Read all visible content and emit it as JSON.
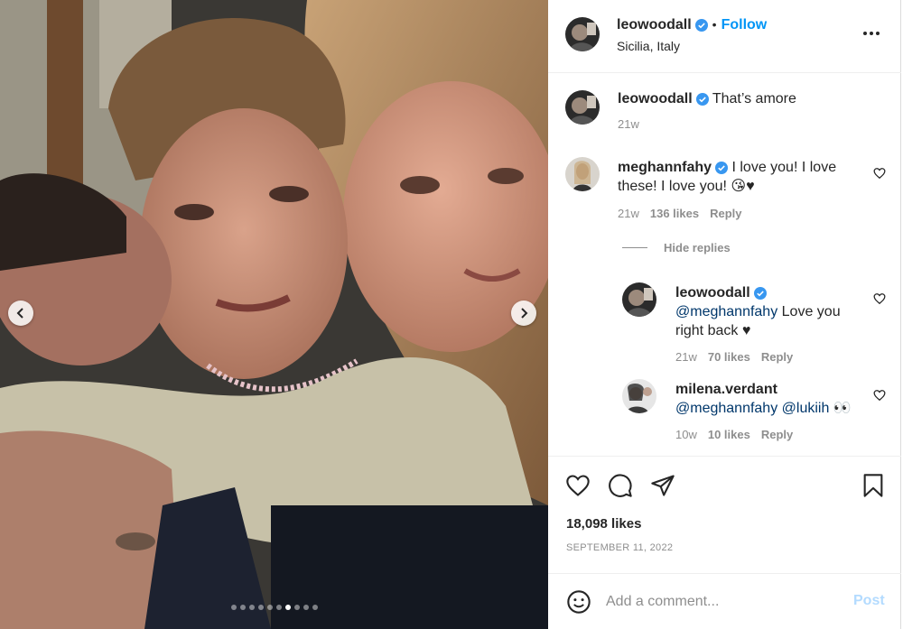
{
  "post": {
    "author": "leowoodall",
    "location": "Sicilia, Italy",
    "follow_label": "Follow",
    "bullet": "•",
    "caption": {
      "user": "leowoodall",
      "text": "That’s amore",
      "time": "21w"
    },
    "comments": [
      {
        "user": "meghannfahy",
        "text_line1": "I love you! I love",
        "text_line2": "these! I love you! 😘♥",
        "time": "21w",
        "likes": "136 likes",
        "reply": "Reply",
        "hide_replies": "Hide replies",
        "replies": [
          {
            "user": "leowoodall",
            "mention": "@meghannfahy",
            "text": " Love you",
            "text_line2": "right back ♥",
            "time": "21w",
            "likes": "70 likes",
            "reply": "Reply"
          },
          {
            "user": "milena.verdant",
            "mention1": "@meghannfahy",
            "mention2": "@lukiih",
            "emoji": " 👀",
            "time": "10w",
            "likes": "10 likes",
            "reply": "Reply"
          }
        ]
      }
    ],
    "likes_total": "18,098 likes",
    "date": "SEPTEMBER 11, 2022",
    "comment_placeholder": "Add a comment...",
    "post_label": "Post",
    "carousel": {
      "total_slides": 10,
      "active_slide": 7
    }
  },
  "icons": {
    "more": "more-options-icon",
    "verified": "verified-badge-icon",
    "like": "heart-icon",
    "comment": "comment-icon",
    "share": "share-icon",
    "save": "bookmark-icon",
    "emoji": "emoji-icon",
    "prev": "chevron-left-icon",
    "next": "chevron-right-icon"
  },
  "colors": {
    "accent": "#0095f6",
    "verified": "#3897f0",
    "mention": "#00376b",
    "muted": "#8e8e8e",
    "post_disabled": "#b3dbff"
  }
}
